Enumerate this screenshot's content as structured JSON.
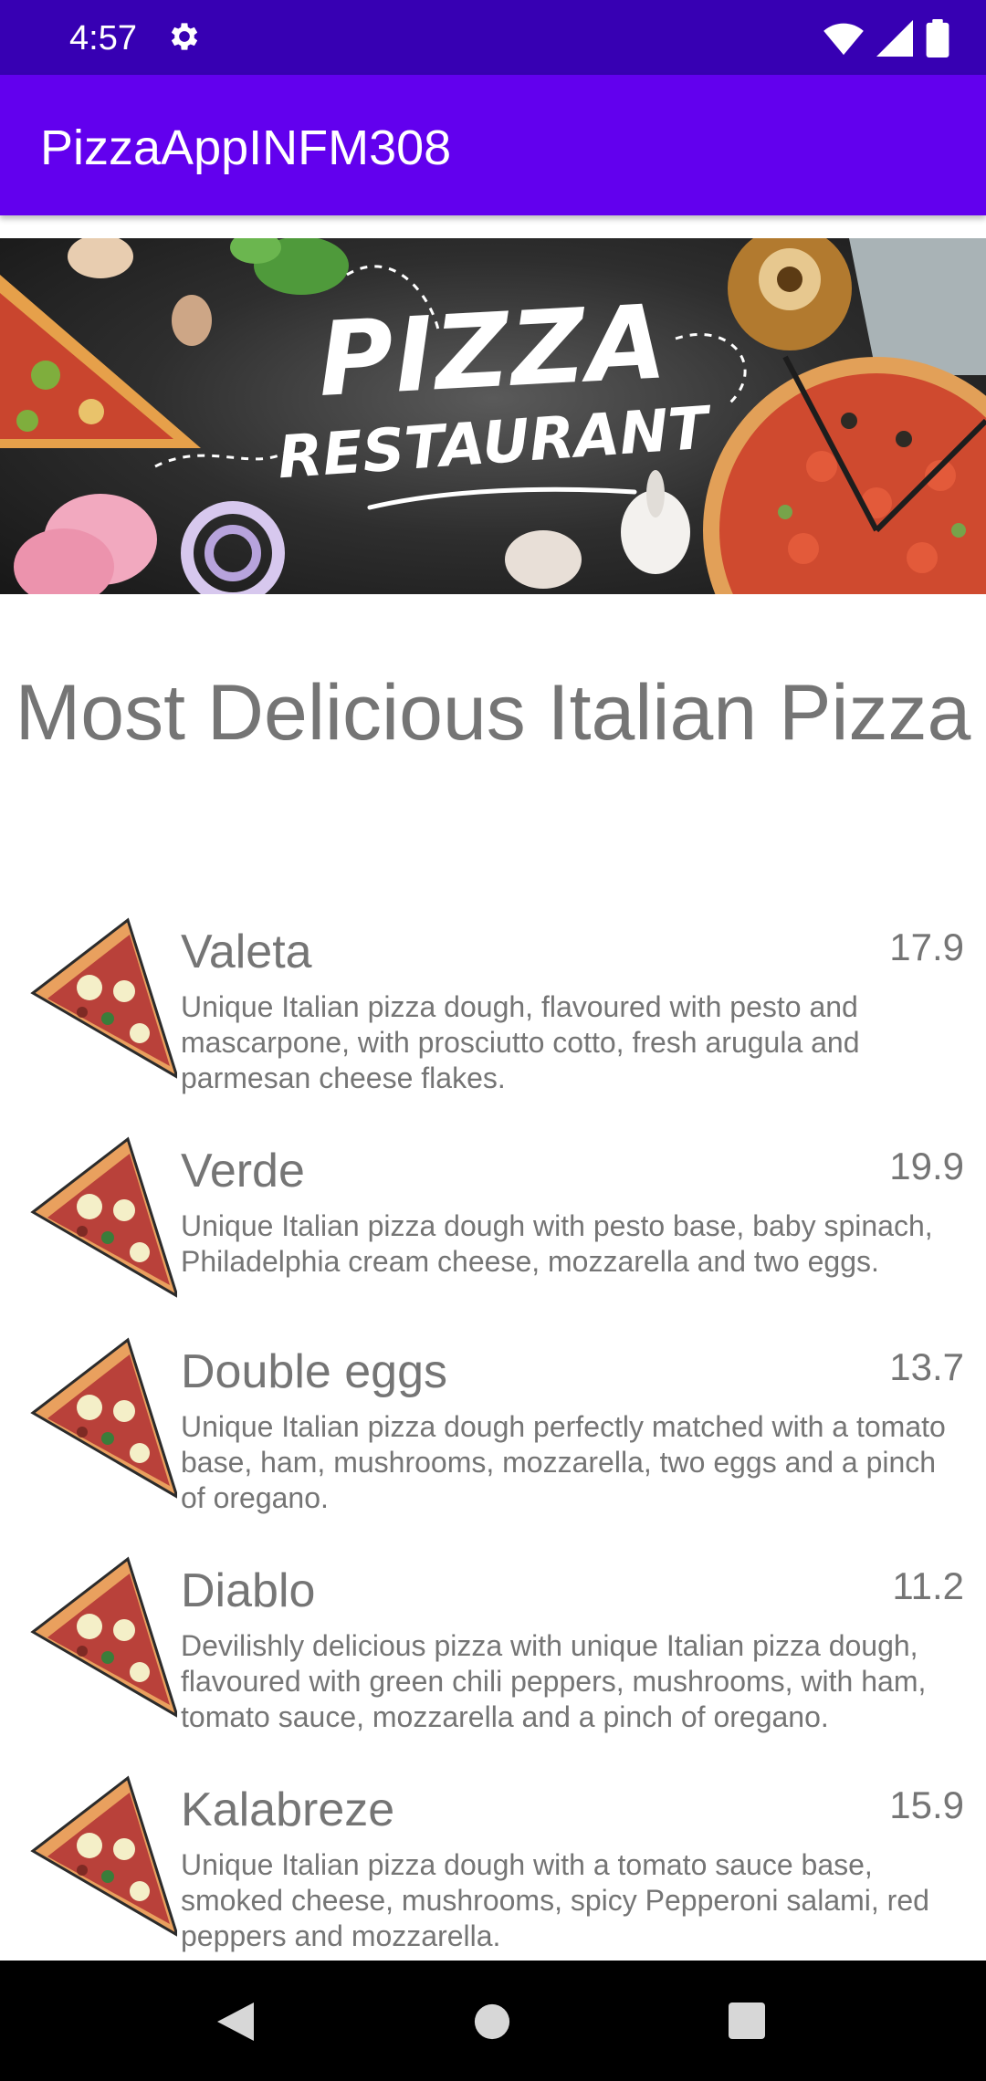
{
  "status_bar": {
    "time": "4:57"
  },
  "app_bar": {
    "title": "PizzaAppINFM308"
  },
  "banner": {
    "title": "PIZZA",
    "subtitle": "RESTAURANT"
  },
  "headline": "Most Delicious Italian Pizza",
  "pizzas": [
    {
      "name": "Valeta",
      "price": "17.9",
      "description": "Unique Italian pizza dough, flavoured with pesto and mascarpone, with prosciutto cotto, fresh arugula and parmesan cheese flakes."
    },
    {
      "name": "Verde",
      "price": "19.9",
      "description": "Unique Italian pizza dough with pesto base, baby spinach, Philadelphia cream cheese, mozzarella and two eggs."
    },
    {
      "name": "Double eggs",
      "price": "13.7",
      "description": "Unique Italian pizza dough perfectly matched with a tomato base, ham, mushrooms, mozzarella, two eggs and a pinch of oregano."
    },
    {
      "name": "Diablo",
      "price": "11.2",
      "description": "Devilishly delicious pizza with unique Italian pizza dough, flavoured with green chili peppers, mushrooms, with ham, tomato sauce, mozzarella and a pinch of oregano."
    },
    {
      "name": "Kalabreze",
      "price": "15.9",
      "description": "Unique Italian pizza dough with a tomato sauce base, smoked cheese, mushrooms, spicy Pepperoni salami, red peppers and mozzarella."
    }
  ],
  "colors": {
    "status_bar": "#3700b3",
    "app_bar": "#6200ee",
    "text_gray": "#757575"
  },
  "icons": [
    "settings-gear-icon",
    "wifi-icon",
    "cellular-signal-icon",
    "battery-icon",
    "pizza-slice-icon",
    "nav-back-icon",
    "nav-home-icon",
    "nav-recents-icon"
  ]
}
